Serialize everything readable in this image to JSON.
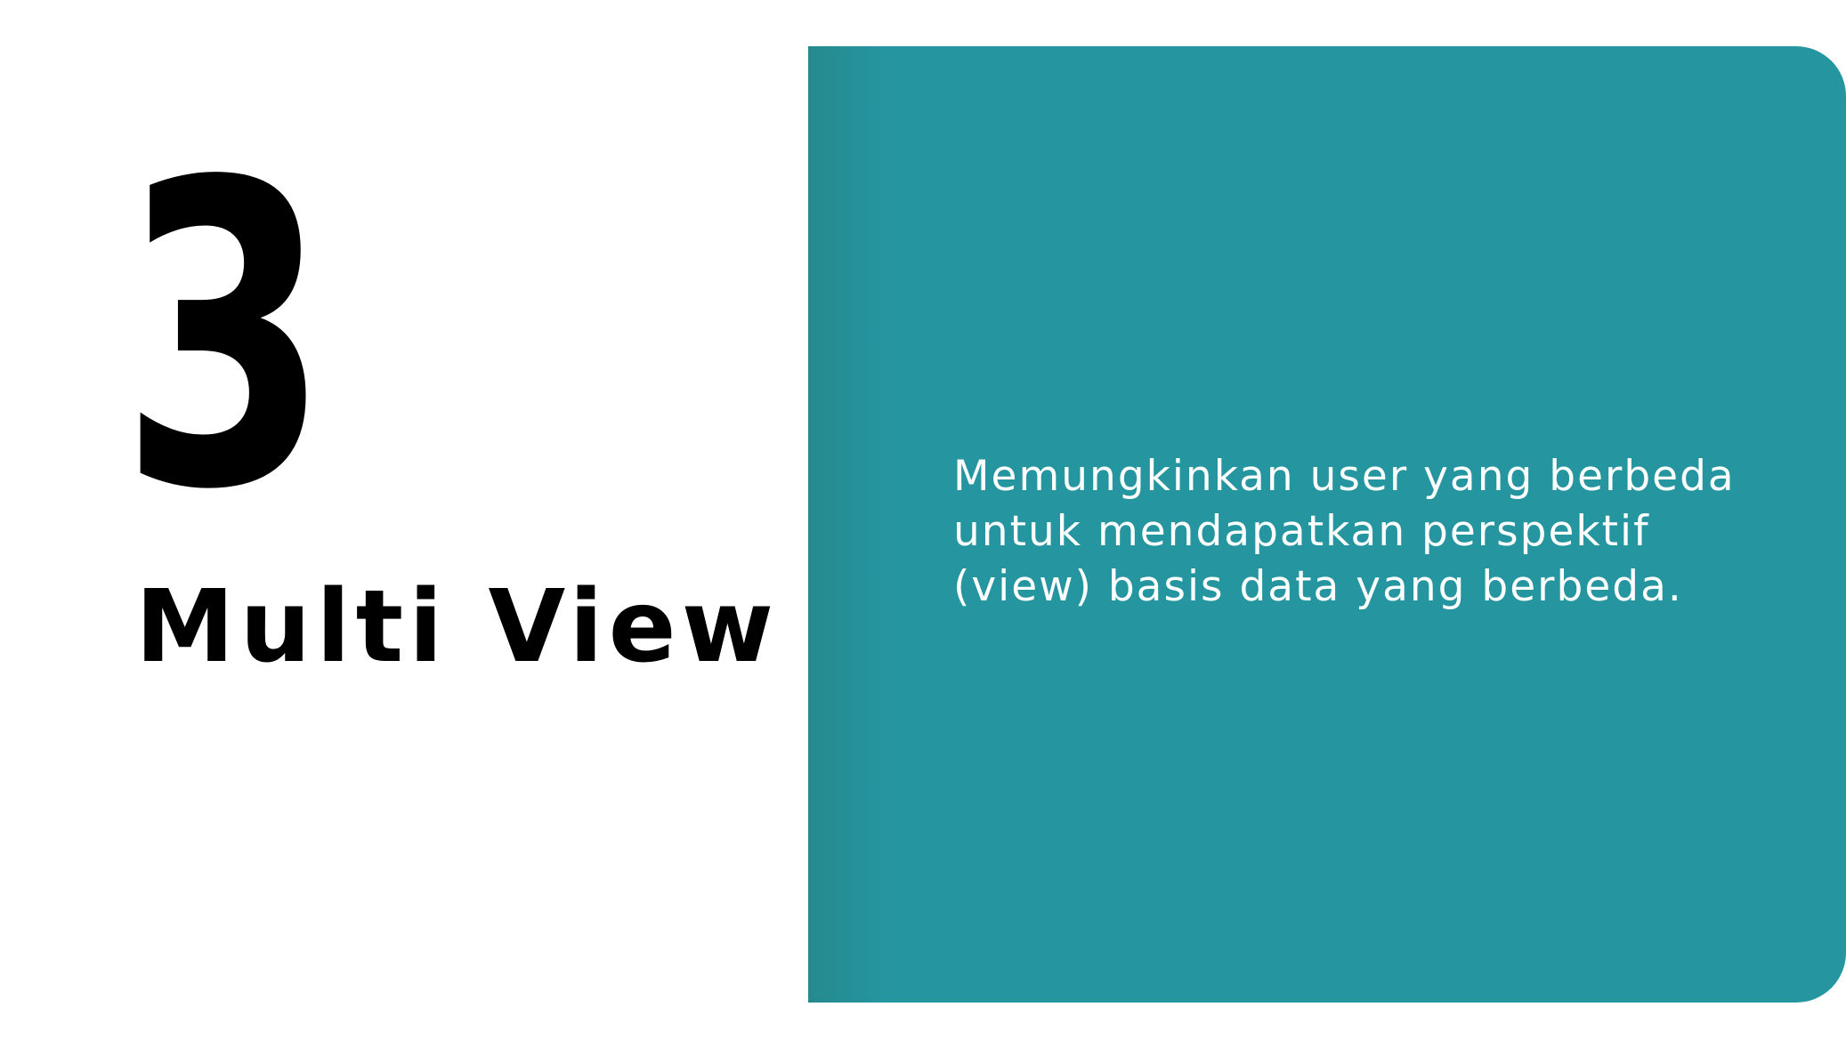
{
  "slide": {
    "number": "3",
    "title": "Multi View",
    "description_lines": [
      "Memungkinkan user yang berbeda",
      "untuk mendapatkan perspektif",
      "(view) basis data yang berbeda."
    ]
  },
  "colors": {
    "background": "#ffffff",
    "panel": "#2596a0",
    "panel_edge": "#258a8f",
    "text_dark": "#000000",
    "text_light": "#ffffff"
  }
}
